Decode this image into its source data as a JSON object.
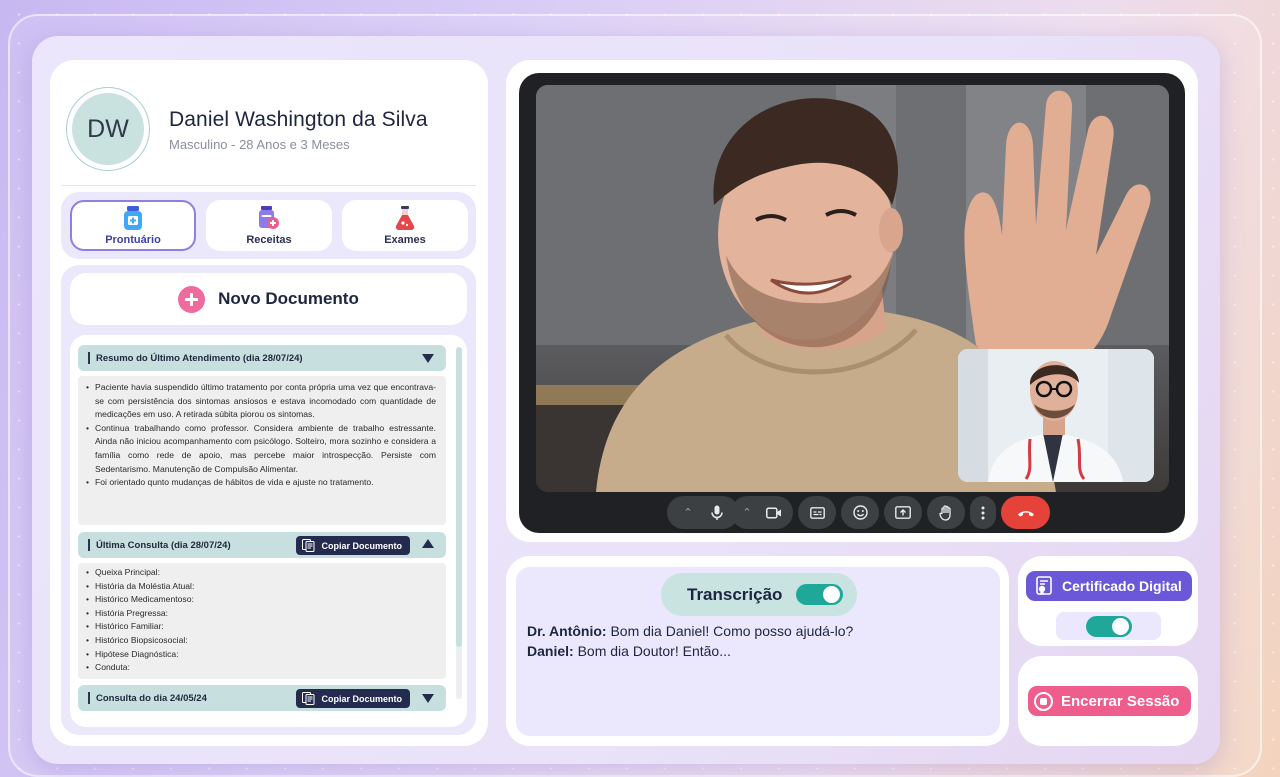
{
  "patient": {
    "initials": "DW",
    "name": "Daniel Washington da Silva",
    "details": "Masculino - 28 Anos e 3 Meses"
  },
  "tabs": [
    {
      "label": "Prontuário",
      "icon": "medicine-bottle-icon",
      "active": true
    },
    {
      "label": "Receitas",
      "icon": "prescription-icon",
      "active": false
    },
    {
      "label": "Exames",
      "icon": "flask-icon",
      "active": false
    }
  ],
  "new_document": {
    "label": "Novo Documento",
    "icon": "plus-icon"
  },
  "documents": {
    "resumo": {
      "title": "Resumo do Último Atendimento  (dia 28/07/24)",
      "bullets": [
        "Paciente havia suspendido último tratamento por conta própria uma vez que encontrava-se com persistência dos sintomas ansiosos e estava incomodado com quantidade de medicações em uso. A retirada súbita piorou os sintomas.",
        "Continua trabalhando como professor. Considera ambiente de trabalho estressante. Ainda não iniciou acompanhamento com psicólogo. Solteiro, mora sozinho e considera a família como rede de apoio, mas percebe maior introspecção. Persiste com Sedentarismo. Manutenção de Compulsão Alimentar.",
        "Foi orientado qunto mudanças de hábitos de vida e ajuste no tratamento."
      ]
    },
    "ultima": {
      "title": "Última Consulta  (dia 28/07/24)",
      "copy_label": "Copiar Documento",
      "fields": [
        "Queixa Principal:",
        "História da Moléstia Atual:",
        "Histórico Medicamentoso:",
        "História Pregressa:",
        "Histórico Familiar:",
        "Histórico Biopsicosocial:",
        "Hipótese Diagnóstica:",
        "Conduta:"
      ]
    },
    "anterior": {
      "title": "Consulta do dia  24/05/24",
      "copy_label": "Copiar Documento"
    }
  },
  "video_controls": [
    "mic-icon",
    "camera-icon",
    "captions-icon",
    "emoji-icon",
    "present-icon",
    "raise-hand-icon",
    "more-icon",
    "hang-up-icon"
  ],
  "transcription": {
    "label": "Transcrição",
    "enabled": true,
    "lines": [
      {
        "speaker": "Dr. Antônio:",
        "text": " Bom dia Daniel! Como posso ajudá-lo?"
      },
      {
        "speaker": "Daniel:",
        "text": " Bom dia Doutor! Então..."
      }
    ]
  },
  "certificate": {
    "label": "Certificado Digital",
    "enabled": true
  },
  "end_session": {
    "label": "Encerrar Sessão"
  },
  "colors": {
    "accent_purple": "#6b58d8",
    "accent_pink": "#ef5d8c",
    "teal": "#1fa89a",
    "teal_light": "#c7e0df",
    "navy": "#252a4f",
    "hangup_red": "#e5423a"
  }
}
